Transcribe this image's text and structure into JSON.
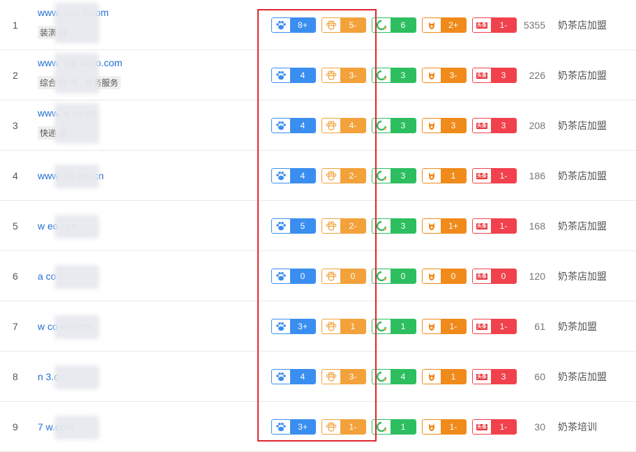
{
  "colors": {
    "baidu": "#3a8ef0",
    "so360": "#f3a13a",
    "sogou": "#2dbe60",
    "shenma": "#f08a1a",
    "toutiao": "#f0414c",
    "highlight": "#e0262e",
    "link": "#1f6fd1"
  },
  "icons": {
    "baidu": "paw-icon",
    "so360": "so360-icon",
    "sogou": "sogou-icon",
    "shenma": "shenma-icon",
    "toutiao": "toutiao-icon"
  },
  "toutiao_icon_text": "头条",
  "rows": [
    {
      "rank": "1",
      "domain": "www.    ush  0.com",
      "tags": [
        "装潢    材"
      ],
      "baidu": "8+",
      "so360": "5-",
      "sogou": "6",
      "shenma": "2+",
      "toutiao": "1-",
      "count": "5355",
      "keyword": "奶茶店加盟"
    },
    {
      "rank": "2",
      "domain": "www.   nqi   ubao.com",
      "tags": [
        "综合     网     气",
        "票务服务"
      ],
      "baidu": "4",
      "so360": "3-",
      "sogou": "3",
      "shenma": "3-",
      "toutiao": "3",
      "count": "226",
      "keyword": "奶茶店加盟"
    },
    {
      "rank": "3",
      "domain": "www.     a    vo.cn",
      "tags": [
        "快递         递"
      ],
      "baidu": "4",
      "so360": "4-",
      "sogou": "3",
      "shenma": "3",
      "toutiao": "3",
      "count": "208",
      "keyword": "奶茶店加盟"
    },
    {
      "rank": "4",
      "domain": "www.   68    om.cn",
      "tags": [],
      "baidu": "4",
      "so360": "2-",
      "sogou": "3",
      "shenma": "1",
      "toutiao": "1-",
      "count": "186",
      "keyword": "奶茶店加盟"
    },
    {
      "rank": "5",
      "domain": "w     eo   t.cn",
      "tags": [],
      "baidu": "5",
      "so360": "2-",
      "sogou": "3",
      "shenma": "1+",
      "toutiao": "1-",
      "count": "168",
      "keyword": "奶茶店加盟"
    },
    {
      "rank": "6",
      "domain": "a        co",
      "tags": [],
      "baidu": "0",
      "so360": "0",
      "sogou": "0",
      "shenma": "0",
      "toutiao": "0",
      "count": "120",
      "keyword": "奶茶店加盟"
    },
    {
      "rank": "7",
      "domain": "    w    co    ea.com",
      "tags": [],
      "baidu": "3+",
      "so360": "1",
      "sogou": "1",
      "shenma": "1-",
      "toutiao": "1-",
      "count": "61",
      "keyword": "奶茶加盟"
    },
    {
      "rank": "8",
      "domain": "     n     3.c  n",
      "tags": [],
      "baidu": "4",
      "so360": "3-",
      "sogou": "4",
      "shenma": "1",
      "toutiao": "3",
      "count": "60",
      "keyword": "奶茶店加盟"
    },
    {
      "rank": "9",
      "domain": "          7   w.com",
      "tags": [],
      "baidu": "3+",
      "so360": "1-",
      "sogou": "1",
      "shenma": "1-",
      "toutiao": "1-",
      "count": "30",
      "keyword": "奶茶培训"
    }
  ]
}
